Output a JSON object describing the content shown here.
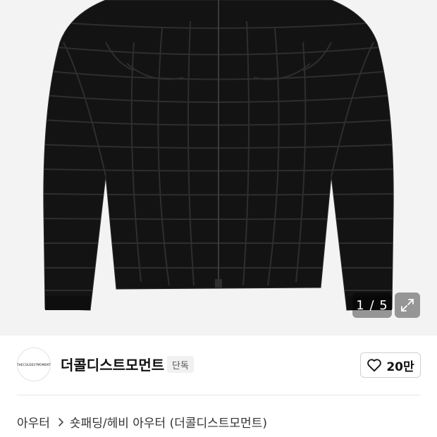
{
  "gallery": {
    "counter": "1 / 5",
    "current_image": 1,
    "total_images": 5,
    "background_color": "#f3f3f3",
    "product_color": "#121212"
  },
  "brand": {
    "logo_text": "THECOLDESTMOMENT",
    "name": "더콜디스트모먼트",
    "badge": "단독"
  },
  "like": {
    "count": "20만",
    "icon": "heart-outline-icon"
  },
  "breadcrumb": {
    "category": "아우터",
    "separator_icon": "chevron-right-icon",
    "subcategory": "숏패딩/헤비 아우터 (더콜디스트모먼트)"
  }
}
